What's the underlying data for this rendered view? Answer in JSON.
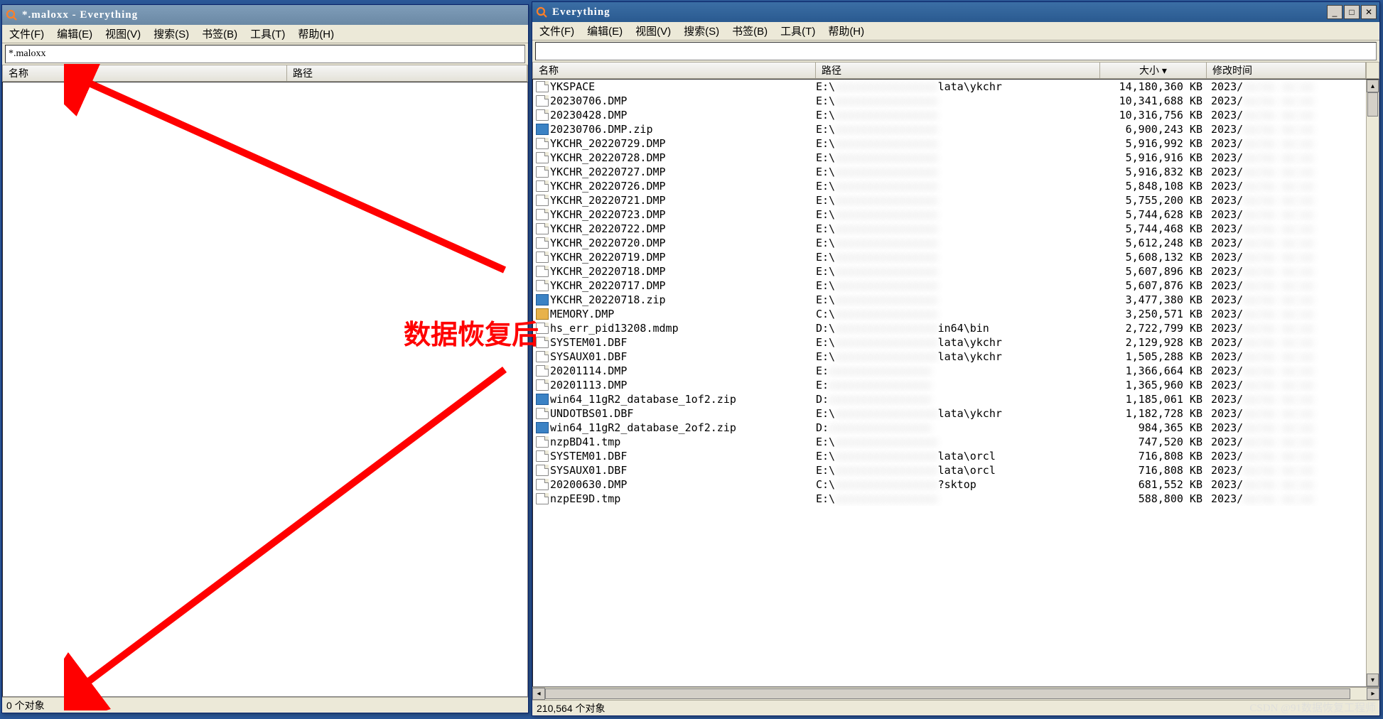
{
  "annotation": {
    "label": "数据恢复后"
  },
  "watermark": "CSDN @91数据恢复工程师",
  "menus": {
    "file": "文件(F)",
    "edit": "编辑(E)",
    "view": "视图(V)",
    "search": "搜索(S)",
    "bookmk": "书签(B)",
    "tools": "工具(T)",
    "help": "帮助(H)"
  },
  "headers": {
    "name": "名称",
    "path": "路径",
    "size": "大小",
    "mtime": "修改时间"
  },
  "win_left": {
    "title": "*.maloxx - Everything",
    "search_value": "*.maloxx",
    "status": "0 个对象"
  },
  "win_right": {
    "title": "Everything",
    "search_value": "",
    "status": "210,564 个对象",
    "rows": [
      {
        "ico": "file",
        "name": "YKSPACE",
        "path": "E:\\",
        "path_tail": "lata\\ykchr",
        "size": "14,180,360 KB",
        "date": "2023/"
      },
      {
        "ico": "file",
        "name": "20230706.DMP",
        "path": "E:\\",
        "path_tail": "",
        "size": "10,341,688 KB",
        "date": "2023/"
      },
      {
        "ico": "file",
        "name": "20230428.DMP",
        "path": "E:\\",
        "path_tail": "",
        "size": "10,316,756 KB",
        "date": "2023/"
      },
      {
        "ico": "zip",
        "name": "20230706.DMP.zip",
        "path": "E:\\",
        "path_tail": "",
        "size": "6,900,243 KB",
        "date": "2023/"
      },
      {
        "ico": "file",
        "name": "YKCHR_20220729.DMP",
        "path": "E:\\",
        "path_tail": "",
        "size": "5,916,992 KB",
        "date": "2023/"
      },
      {
        "ico": "file",
        "name": "YKCHR_20220728.DMP",
        "path": "E:\\",
        "path_tail": "",
        "size": "5,916,916 KB",
        "date": "2023/"
      },
      {
        "ico": "file",
        "name": "YKCHR_20220727.DMP",
        "path": "E:\\",
        "path_tail": "",
        "size": "5,916,832 KB",
        "date": "2023/"
      },
      {
        "ico": "file",
        "name": "YKCHR_20220726.DMP",
        "path": "E:\\",
        "path_tail": "",
        "size": "5,848,108 KB",
        "date": "2023/"
      },
      {
        "ico": "file",
        "name": "YKCHR_20220721.DMP",
        "path": "E:\\",
        "path_tail": "",
        "size": "5,755,200 KB",
        "date": "2023/"
      },
      {
        "ico": "file",
        "name": "YKCHR_20220723.DMP",
        "path": "E:\\",
        "path_tail": "",
        "size": "5,744,628 KB",
        "date": "2023/"
      },
      {
        "ico": "file",
        "name": "YKCHR_20220722.DMP",
        "path": "E:\\",
        "path_tail": "",
        "size": "5,744,468 KB",
        "date": "2023/"
      },
      {
        "ico": "file",
        "name": "YKCHR_20220720.DMP",
        "path": "E:\\",
        "path_tail": "",
        "size": "5,612,248 KB",
        "date": "2023/"
      },
      {
        "ico": "file",
        "name": "YKCHR_20220719.DMP",
        "path": "E:\\",
        "path_tail": "",
        "size": "5,608,132 KB",
        "date": "2023/"
      },
      {
        "ico": "file",
        "name": "YKCHR_20220718.DMP",
        "path": "E:\\",
        "path_tail": "",
        "size": "5,607,896 KB",
        "date": "2023/"
      },
      {
        "ico": "file",
        "name": "YKCHR_20220717.DMP",
        "path": "E:\\",
        "path_tail": "",
        "size": "5,607,876 KB",
        "date": "2023/"
      },
      {
        "ico": "zip",
        "name": "YKCHR_20220718.zip",
        "path": "E:\\",
        "path_tail": "",
        "size": "3,477,380 KB",
        "date": "2023/"
      },
      {
        "ico": "lock",
        "name": "MEMORY.DMP",
        "path": "C:\\",
        "path_tail": "",
        "size": "3,250,571 KB",
        "date": "2023/"
      },
      {
        "ico": "file",
        "name": "hs_err_pid13208.mdmp",
        "path": "D:\\",
        "path_tail": "in64\\bin",
        "size": "2,722,799 KB",
        "date": "2023/"
      },
      {
        "ico": "file",
        "name": "SYSTEM01.DBF",
        "path": "E:\\",
        "path_tail": "lata\\ykchr",
        "size": "2,129,928 KB",
        "date": "2023/"
      },
      {
        "ico": "file",
        "name": "SYSAUX01.DBF",
        "path": "E:\\",
        "path_tail": "lata\\ykchr",
        "size": "1,505,288 KB",
        "date": "2023/"
      },
      {
        "ico": "file",
        "name": "20201114.DMP",
        "path": "E:",
        "path_tail": "",
        "size": "1,366,664 KB",
        "date": "2023/"
      },
      {
        "ico": "file",
        "name": "20201113.DMP",
        "path": "E:",
        "path_tail": "",
        "size": "1,365,960 KB",
        "date": "2023/"
      },
      {
        "ico": "zip",
        "name": "win64_11gR2_database_1of2.zip",
        "path": "D:",
        "path_tail": "",
        "size": "1,185,061 KB",
        "date": "2023/"
      },
      {
        "ico": "file",
        "name": "UNDOTBS01.DBF",
        "path": "E:\\",
        "path_tail": "lata\\ykchr",
        "size": "1,182,728 KB",
        "date": "2023/"
      },
      {
        "ico": "zip",
        "name": "win64_11gR2_database_2of2.zip",
        "path": "D:",
        "path_tail": "",
        "size": "984,365 KB",
        "date": "2023/"
      },
      {
        "ico": "file",
        "name": "nzpBD41.tmp",
        "path": "E:\\",
        "path_tail": "",
        "size": "747,520 KB",
        "date": "2023/"
      },
      {
        "ico": "file",
        "name": "SYSTEM01.DBF",
        "path": "E:\\",
        "path_tail": "lata\\orcl",
        "size": "716,808 KB",
        "date": "2023/"
      },
      {
        "ico": "file",
        "name": "SYSAUX01.DBF",
        "path": "E:\\",
        "path_tail": "lata\\orcl",
        "size": "716,808 KB",
        "date": "2023/"
      },
      {
        "ico": "file",
        "name": "20200630.DMP",
        "path": "C:\\",
        "path_tail": "?sktop",
        "size": "681,552 KB",
        "date": "2023/"
      },
      {
        "ico": "file",
        "name": "nzpEE9D.tmp",
        "path": "E:\\",
        "path_tail": "",
        "size": "588,800 KB",
        "date": "2023/"
      }
    ]
  }
}
